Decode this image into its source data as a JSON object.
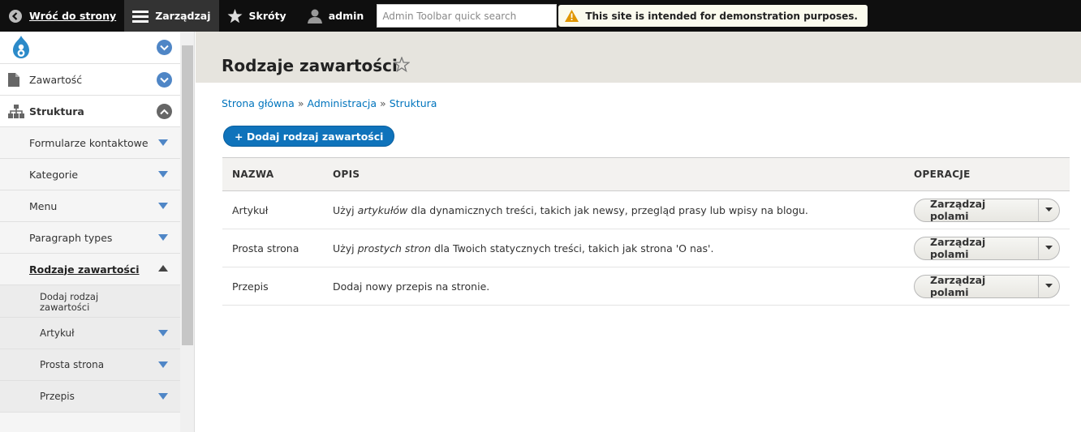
{
  "toolbar": {
    "back_label": "Wróć do strony",
    "manage_label": "Zarządzaj",
    "shortcuts_label": "Skróty",
    "user_label": "admin",
    "search_placeholder": "Admin Toolbar quick search",
    "notice": "This site is intended for demonstration purposes."
  },
  "sidebar": {
    "items": [
      {
        "label": "Zawartość"
      },
      {
        "label": "Struktura"
      },
      {
        "label": "Formularze kontaktowe"
      },
      {
        "label": "Kategorie"
      },
      {
        "label": "Menu"
      },
      {
        "label": "Paragraph types"
      },
      {
        "label": "Rodzaje zawartości"
      },
      {
        "label": "Dodaj rodzaj zawartości"
      },
      {
        "label": "Artykuł"
      },
      {
        "label": "Prosta strona"
      },
      {
        "label": "Przepis"
      }
    ]
  },
  "page": {
    "title": "Rodzaje zawartości",
    "breadcrumb": [
      "Strona główna",
      "Administracja",
      "Struktura"
    ],
    "breadcrumb_separator": "»",
    "add_button": "+ Dodaj rodzaj zawartości"
  },
  "table": {
    "headers": [
      "NAZWA",
      "OPIS",
      "OPERACJE"
    ],
    "rows": [
      {
        "name": "Artykuł",
        "desc_pre": "Użyj ",
        "desc_em": "artykułów",
        "desc_post": " dla dynamicznych treści, takich jak newsy, przegląd prasy lub wpisy na blogu.",
        "operation": "Zarządzaj polami"
      },
      {
        "name": "Prosta strona",
        "desc_pre": "Użyj ",
        "desc_em": "prostych stron",
        "desc_post": " dla Twoich statycznych treści, takich jak strona 'O nas'.",
        "operation": "Zarządzaj polami"
      },
      {
        "name": "Przepis",
        "desc_pre": "Dodaj nowy przepis na stronie.",
        "desc_em": "",
        "desc_post": "",
        "operation": "Zarządzaj polami"
      }
    ]
  },
  "colors": {
    "accent": "#0f73bb",
    "toolbar_bg": "#0f0f0f",
    "header_bg": "#e6e4de",
    "link": "#0074bd"
  }
}
